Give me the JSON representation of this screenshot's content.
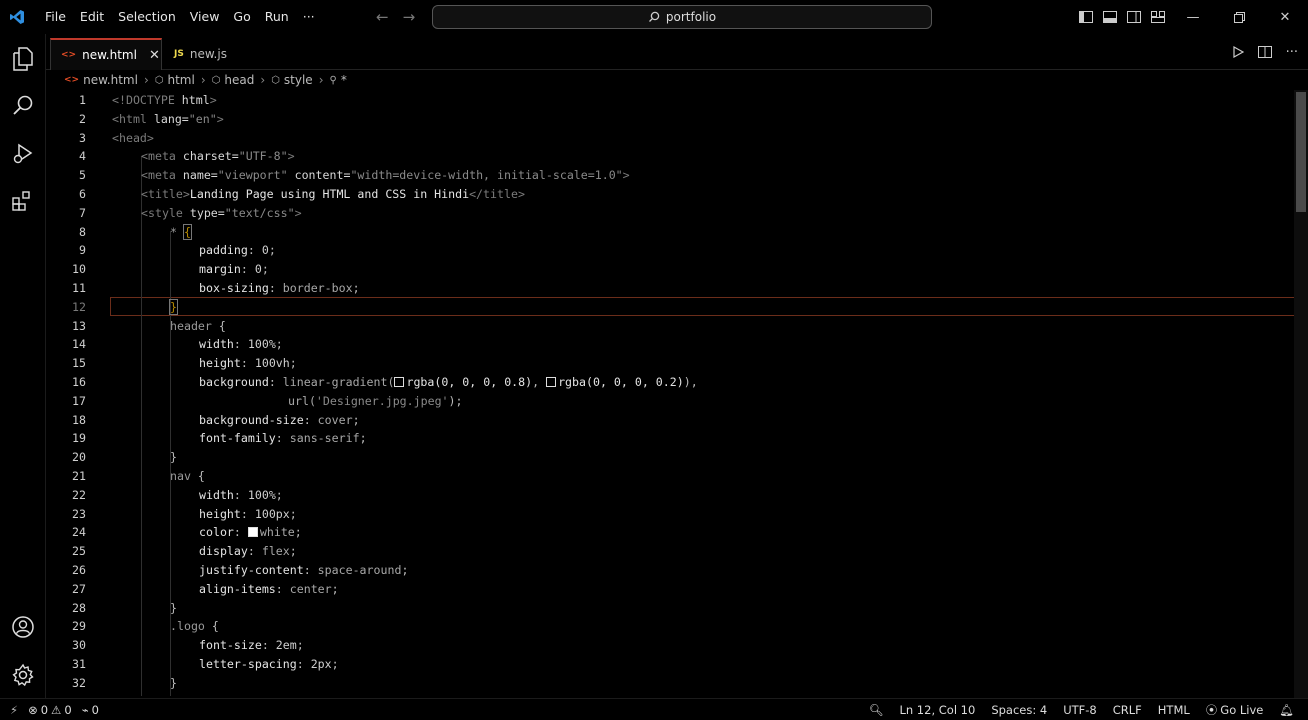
{
  "title_bar": {
    "menu": [
      "File",
      "Edit",
      "Selection",
      "View",
      "Go",
      "Run",
      "···"
    ],
    "search_text": "portfolio"
  },
  "tabs": [
    {
      "label": "new.html",
      "icon": "<>",
      "active": true,
      "icon_color": "#e44d26"
    },
    {
      "label": "new.js",
      "icon": "JS",
      "active": false,
      "icon_color": "#f0db4f"
    }
  ],
  "breadcrumb": [
    "new.html",
    "html",
    "head",
    "style",
    "*"
  ],
  "editor": {
    "current_line": 12,
    "lines": [
      {
        "n": "1"
      },
      {
        "n": "2"
      },
      {
        "n": "3"
      },
      {
        "n": "4"
      },
      {
        "n": "5"
      },
      {
        "n": "6"
      },
      {
        "n": "7"
      },
      {
        "n": "8"
      },
      {
        "n": "9"
      },
      {
        "n": "10"
      },
      {
        "n": "11"
      },
      {
        "n": "12"
      },
      {
        "n": "13"
      },
      {
        "n": "14"
      },
      {
        "n": "15"
      },
      {
        "n": "16"
      },
      {
        "n": "17"
      },
      {
        "n": "18"
      },
      {
        "n": "19"
      },
      {
        "n": "20"
      },
      {
        "n": "21"
      },
      {
        "n": "22"
      },
      {
        "n": "23"
      },
      {
        "n": "24"
      },
      {
        "n": "25"
      },
      {
        "n": "26"
      },
      {
        "n": "27"
      },
      {
        "n": "28"
      },
      {
        "n": "29"
      },
      {
        "n": "30"
      },
      {
        "n": "31"
      },
      {
        "n": "32"
      }
    ],
    "code": {
      "l1": [
        "<!DOCTYPE",
        " html",
        ">"
      ],
      "l2": [
        "<html",
        " lang=",
        "\"en\"",
        ">"
      ],
      "l3": [
        "<head>"
      ],
      "l4": [
        "<meta",
        " charset=",
        "\"UTF-8\"",
        ">"
      ],
      "l5": [
        "<meta",
        " name=",
        "\"viewport\"",
        " content=",
        "\"width=device-width, initial-scale=1.0\"",
        ">"
      ],
      "l6": [
        "<title>",
        "Landing Page using HTML and CSS in Hindi",
        "</title>"
      ],
      "l7": [
        "<style",
        " type=",
        "\"text/css\"",
        ">"
      ],
      "l8": [
        "* ",
        "{"
      ],
      "l9": [
        "padding",
        ": ",
        "0",
        ";"
      ],
      "l10": [
        "margin",
        ": ",
        "0",
        ";"
      ],
      "l11": [
        "box-sizing",
        ": ",
        "border-box",
        ";"
      ],
      "l12": [
        "}"
      ],
      "l13": [
        "header",
        " {"
      ],
      "l14": [
        "width",
        ": ",
        "100%",
        ";"
      ],
      "l15": [
        "height",
        ": ",
        "100vh",
        ";"
      ],
      "l16": [
        "background",
        ": ",
        "linear-gradient(",
        "rgba(0, 0, 0, 0.8)",
        ", ",
        "rgba(0, 0, 0, 0.2)",
        "),"
      ],
      "l17": [
        "url(",
        "'Designer.jpg.jpeg'",
        ");"
      ],
      "l18": [
        "background-size",
        ": ",
        "cover",
        ";"
      ],
      "l19": [
        "font-family",
        ": ",
        "sans-serif",
        ";"
      ],
      "l20": [
        "}"
      ],
      "l21": [
        "nav",
        " {"
      ],
      "l22": [
        "width",
        ": ",
        "100%",
        ";"
      ],
      "l23": [
        "height",
        ": ",
        "100px",
        ";"
      ],
      "l24": [
        "color",
        ": ",
        "white",
        ";"
      ],
      "l25": [
        "display",
        ": ",
        "flex",
        ";"
      ],
      "l26": [
        "justify-content",
        ": ",
        "space-around",
        ";"
      ],
      "l27": [
        "align-items",
        ": ",
        "center",
        ";"
      ],
      "l28": [
        "}"
      ],
      "l29": [
        ".logo",
        " {"
      ],
      "l30": [
        "font-size",
        ": ",
        "2em",
        ";"
      ],
      "l31": [
        "letter-spacing",
        ": ",
        "2px",
        ";"
      ],
      "l32": [
        "}"
      ]
    }
  },
  "status_bar": {
    "errors": "0",
    "warnings": "0",
    "ports": "0",
    "position": "Ln 12, Col 10",
    "spaces": "Spaces: 4",
    "encoding": "UTF-8",
    "eol": "CRLF",
    "language": "HTML",
    "go_live": "Go Live"
  }
}
